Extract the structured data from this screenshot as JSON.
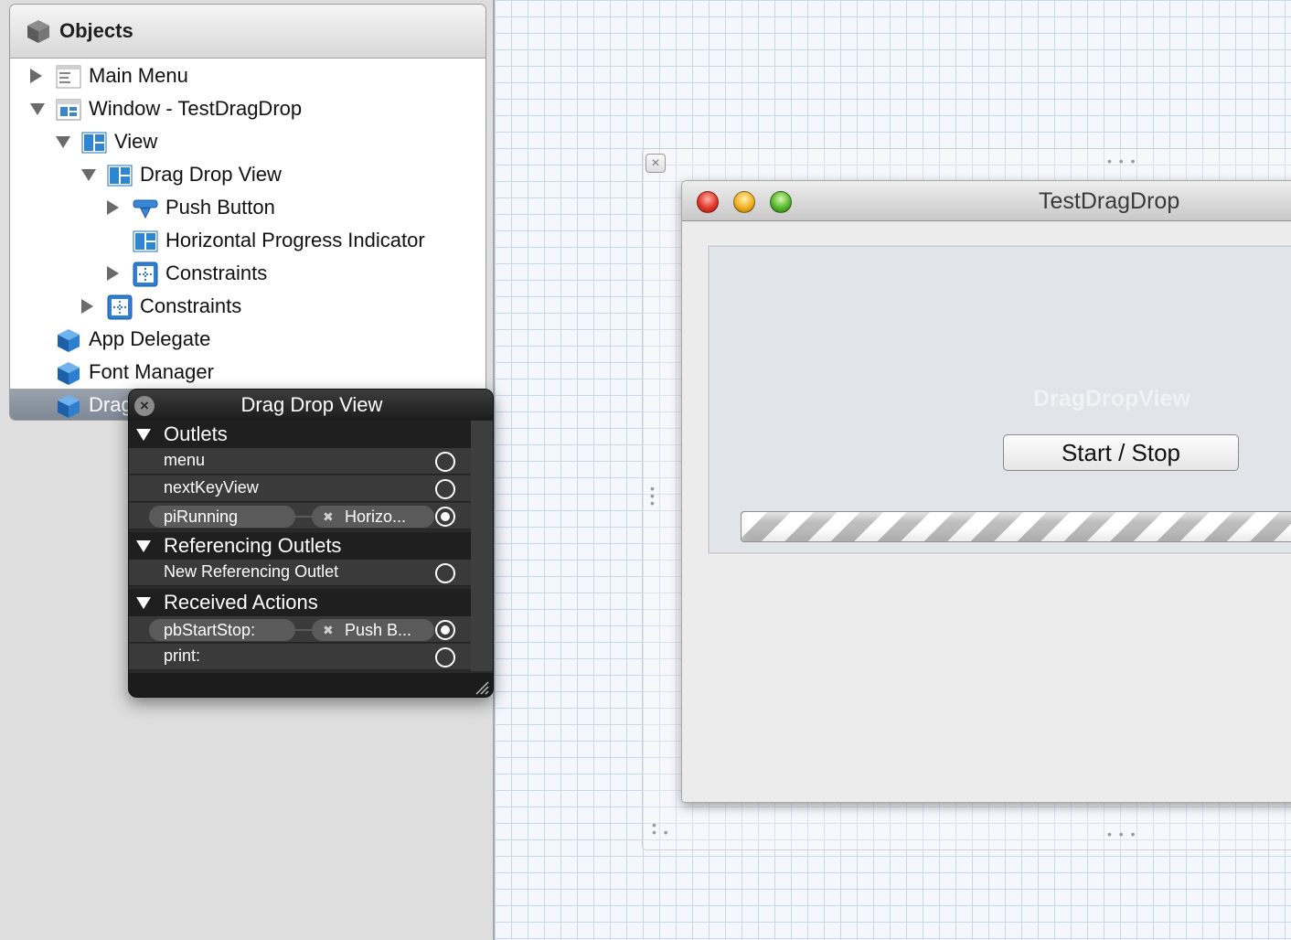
{
  "objects_panel": {
    "title": "Objects",
    "items": [
      {
        "label": "Main Menu"
      },
      {
        "label": "Window - TestDragDrop"
      },
      {
        "label": "View"
      },
      {
        "label": "Drag Drop View"
      },
      {
        "label": "Push Button"
      },
      {
        "label": "Horizontal Progress Indicator"
      },
      {
        "label": "Constraints"
      },
      {
        "label": "Constraints"
      },
      {
        "label": "App Delegate"
      },
      {
        "label": "Font Manager"
      },
      {
        "label": "Drag"
      }
    ]
  },
  "hud": {
    "title": "Drag Drop View",
    "sections": {
      "outlets": "Outlets",
      "referencing_outlets": "Referencing Outlets",
      "received_actions": "Received Actions"
    },
    "outlets": [
      {
        "name": "menu"
      },
      {
        "name": "nextKeyView"
      },
      {
        "name": "piRunning",
        "target": "Horizo..."
      }
    ],
    "referencing": [
      {
        "name": "New Referencing Outlet"
      }
    ],
    "actions": [
      {
        "name": "pbStartStop:",
        "target": "Push B..."
      },
      {
        "name": "print:"
      }
    ]
  },
  "app_window": {
    "title": "TestDragDrop",
    "view_label": "DragDropView",
    "button_label": "Start / Stop"
  },
  "colors": {
    "canvas_grid": "#c6d8ef",
    "hud_background": "#2a2a2a",
    "selection": "#8a94a0"
  }
}
